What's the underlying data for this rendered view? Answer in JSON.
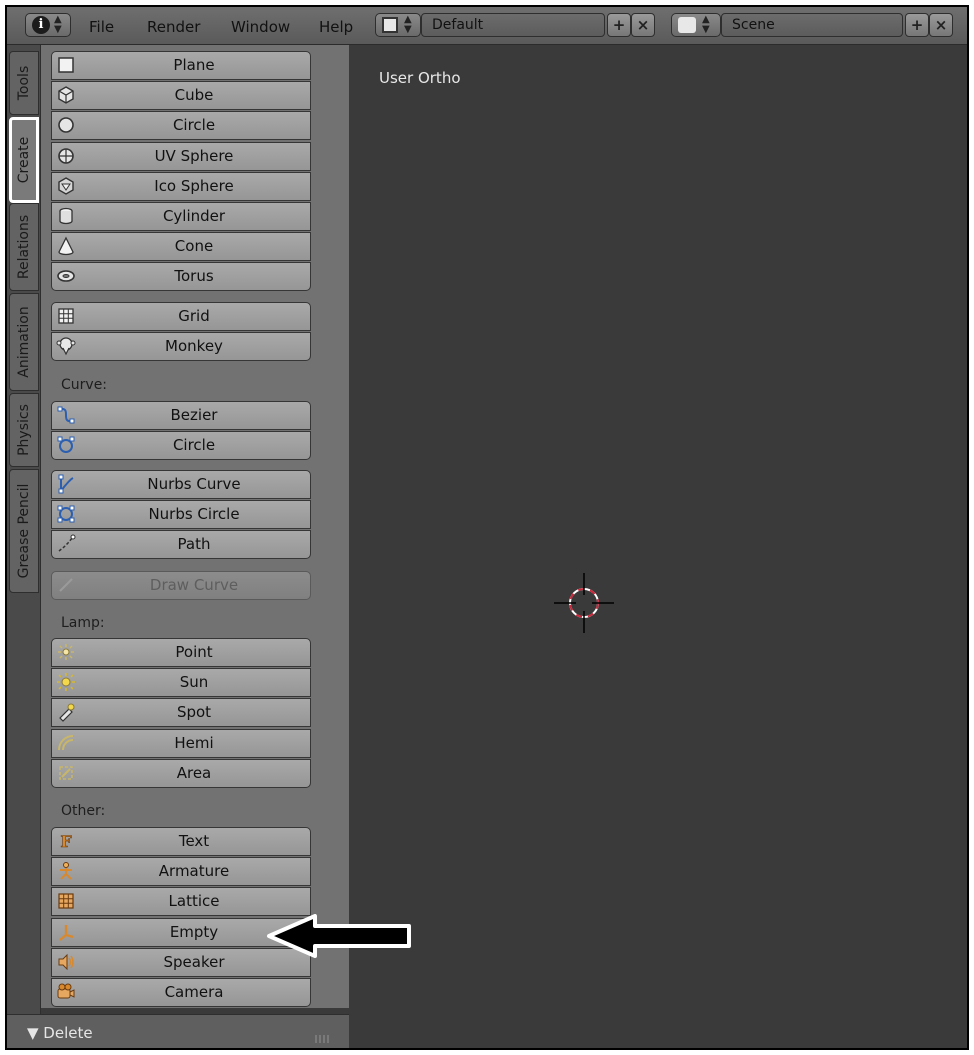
{
  "header": {
    "info_icon": "info-icon",
    "menu": [
      "File",
      "Render",
      "Window",
      "Help"
    ],
    "screen_layout": "Default",
    "scene": "Scene"
  },
  "tabs": [
    "Tools",
    "Create",
    "Relations",
    "Animation",
    "Physics",
    "Grease Pencil"
  ],
  "active_tab": "Create",
  "panel": {
    "mesh_group1": [
      {
        "label": "Plane",
        "icon": "plane-icon"
      },
      {
        "label": "Cube",
        "icon": "cube-icon"
      },
      {
        "label": "Circle",
        "icon": "circle-icon"
      },
      {
        "label": "UV Sphere",
        "icon": "uv-sphere-icon"
      },
      {
        "label": "Ico Sphere",
        "icon": "ico-sphere-icon"
      },
      {
        "label": "Cylinder",
        "icon": "cylinder-icon"
      },
      {
        "label": "Cone",
        "icon": "cone-icon"
      },
      {
        "label": "Torus",
        "icon": "torus-icon"
      }
    ],
    "mesh_group2": [
      {
        "label": "Grid",
        "icon": "grid-icon"
      },
      {
        "label": "Monkey",
        "icon": "monkey-icon"
      }
    ],
    "curve_label": "Curve:",
    "curve_group1": [
      {
        "label": "Bezier",
        "icon": "bezier-icon"
      },
      {
        "label": "Circle",
        "icon": "bezier-circle-icon"
      }
    ],
    "curve_group2": [
      {
        "label": "Nurbs Curve",
        "icon": "nurbs-curve-icon"
      },
      {
        "label": "Nurbs Circle",
        "icon": "nurbs-circle-icon"
      },
      {
        "label": "Path",
        "icon": "path-icon"
      }
    ],
    "draw_curve": "Draw Curve",
    "lamp_label": "Lamp:",
    "lamp_group": [
      {
        "label": "Point",
        "icon": "point-lamp-icon"
      },
      {
        "label": "Sun",
        "icon": "sun-lamp-icon"
      },
      {
        "label": "Spot",
        "icon": "spot-lamp-icon"
      },
      {
        "label": "Hemi",
        "icon": "hemi-lamp-icon"
      },
      {
        "label": "Area",
        "icon": "area-lamp-icon"
      }
    ],
    "other_label": "Other:",
    "other_group": [
      {
        "label": "Text",
        "icon": "text-icon"
      },
      {
        "label": "Armature",
        "icon": "armature-icon"
      },
      {
        "label": "Lattice",
        "icon": "lattice-icon"
      },
      {
        "label": "Empty",
        "icon": "empty-icon"
      },
      {
        "label": "Speaker",
        "icon": "speaker-icon"
      },
      {
        "label": "Camera",
        "icon": "camera-icon"
      }
    ]
  },
  "footer": {
    "label": "▼ Delete"
  },
  "viewport": {
    "label": "User Ortho"
  },
  "colors": {
    "panel_bg": "#727272",
    "viewport_bg": "#3a3a3a",
    "button_bg": "#a0a0a0",
    "cursor_ring": "#c8283c"
  }
}
